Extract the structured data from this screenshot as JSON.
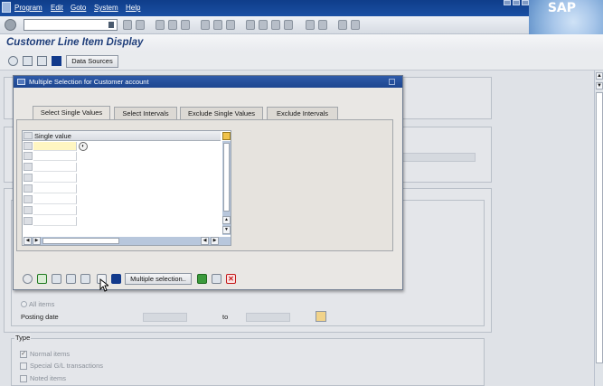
{
  "menubar": {
    "items": [
      "Program",
      "Edit",
      "Goto",
      "System",
      "Help"
    ],
    "logo": "SAP"
  },
  "system_toolbar": {
    "command_field_value": ""
  },
  "screen": {
    "title": "Customer Line Item Display"
  },
  "app_toolbar": {
    "data_sources_label": "Data Sources"
  },
  "background": {
    "all_items_label": "All items",
    "posting_date_label": "Posting date",
    "to_label": "to",
    "type_label": "Type",
    "normal_items_label": "Normal items",
    "special_gl_label": "Special G/L transactions",
    "noted_items_label": "Noted items"
  },
  "dialog": {
    "title": "Multiple Selection for Customer account",
    "tabs": [
      "Select Single Values",
      "Select Intervals",
      "Exclude Single Values",
      "Exclude Intervals"
    ],
    "active_tab": "Select Single Values",
    "grid": {
      "column_header": "Single value",
      "rows": [
        "",
        "",
        "",
        "",
        "",
        "",
        "",
        ""
      ]
    },
    "multiple_selection_label": "Multiple selection.."
  },
  "colors": {
    "menubar": "#1a4fa3",
    "title_text": "#1f3e7a",
    "dialog_title": "#1d4690",
    "cancel_red": "#c41a1a",
    "confirm_green": "#1f7a1f",
    "info_blue": "#123a8c"
  }
}
